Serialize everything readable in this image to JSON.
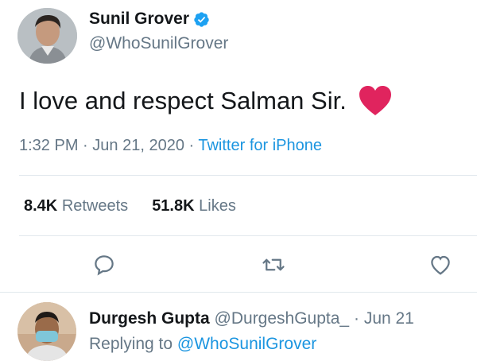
{
  "tweet": {
    "author": {
      "display_name": "Sunil Grover",
      "handle": "@WhoSunilGrover",
      "verified": true
    },
    "text": "I love and respect Salman Sir.",
    "emoji": "heart-emoji",
    "time": "1:32 PM",
    "date": "Jun 21, 2020",
    "separator": "·",
    "source": "Twitter for iPhone",
    "stats": {
      "retweets_count": "8.4K",
      "retweets_label": "Retweets",
      "likes_count": "51.8K",
      "likes_label": "Likes"
    }
  },
  "actions": [
    {
      "name": "reply",
      "icon": "reply-icon"
    },
    {
      "name": "retweet",
      "icon": "retweet-icon"
    },
    {
      "name": "like",
      "icon": "like-icon"
    }
  ],
  "reply": {
    "display_name": "Durgesh Gupta",
    "handle": "@DurgeshGupta_",
    "separator": "·",
    "date": "Jun 21",
    "replying_label": "Replying to",
    "replying_to": "@WhoSunilGrover"
  },
  "colors": {
    "link": "#1b95e0",
    "secondary_text": "#657786",
    "primary_text": "#14171a",
    "heart": "#e0245e"
  }
}
